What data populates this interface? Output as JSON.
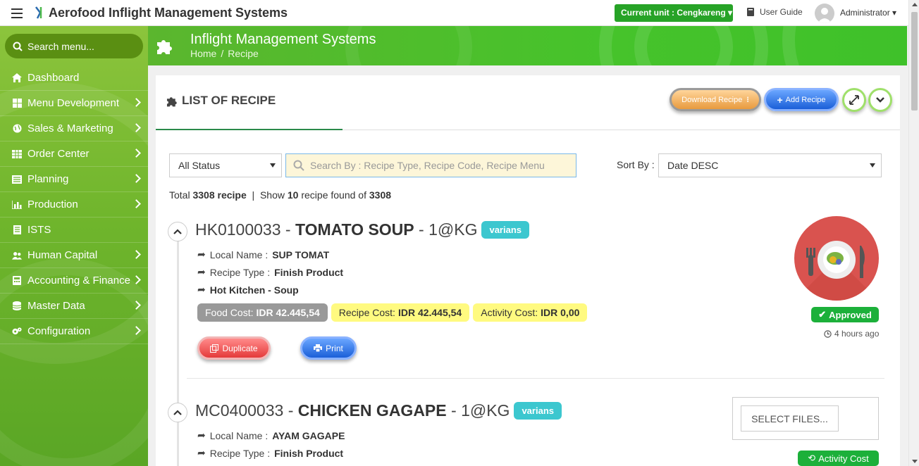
{
  "topbar": {
    "app_title": "Aerofood Inflight Management Systems",
    "unit_button": "Current unit : Cengkareng",
    "user_guide": "User Guide",
    "user": "Administrator"
  },
  "sidebar": {
    "search_placeholder": "Search menu...",
    "items": [
      {
        "label": "Dashboard",
        "icon": "home-icon",
        "has_submenu": false
      },
      {
        "label": "Menu Development",
        "icon": "windows-icon",
        "has_submenu": true
      },
      {
        "label": "Sales & Marketing",
        "icon": "globe-icon",
        "has_submenu": true
      },
      {
        "label": "Order Center",
        "icon": "grid-icon",
        "has_submenu": true
      },
      {
        "label": "Planning",
        "icon": "list-icon",
        "has_submenu": true
      },
      {
        "label": "Production",
        "icon": "bar-chart-icon",
        "has_submenu": true
      },
      {
        "label": "ISTS",
        "icon": "document-icon",
        "has_submenu": false
      },
      {
        "label": "Human Capital",
        "icon": "users-icon",
        "has_submenu": true
      },
      {
        "label": "Accounting & Finance",
        "icon": "calculator-icon",
        "has_submenu": true
      },
      {
        "label": "Master Data",
        "icon": "database-icon",
        "has_submenu": true
      },
      {
        "label": "Configuration",
        "icon": "gears-icon",
        "has_submenu": true
      }
    ]
  },
  "banner": {
    "title": "Inflight Management Systems",
    "breadcrumb": [
      "Home",
      "Recipe"
    ]
  },
  "panel": {
    "title": "LIST OF RECIPE",
    "download_button": "Download Recipe",
    "add_button": "Add Recipe"
  },
  "filters": {
    "status_value": "All Status",
    "search_placeholder": "Search By : Recipe Type, Recipe Code, Recipe Menu",
    "sort_label": "Sort By :",
    "sort_value": "Date DESC"
  },
  "summary": {
    "total_prefix": "Total",
    "total_count": "3308 recipe",
    "show_prefix": "Show",
    "show_count": "10",
    "found_text": "recipe found of",
    "found_count": "3308"
  },
  "recipes": [
    {
      "code": "HK0100033",
      "name": "TOMATO SOUP",
      "unit": "1@KG",
      "badge": "varians",
      "local_name_label": "Local Name :",
      "local_name": "SUP TOMAT",
      "type_label": "Recipe Type :",
      "type": "Finish Product",
      "category": "Hot Kitchen - Soup",
      "food_cost_label": "Food Cost:",
      "food_cost": "IDR 42.445,54",
      "recipe_cost_label": "Recipe Cost:",
      "recipe_cost": "IDR 42.445,54",
      "activity_cost_label": "Activity Cost:",
      "activity_cost": "IDR 0,00",
      "duplicate_button": "Duplicate",
      "print_button": "Print",
      "status": "Approved",
      "time_ago": "4 hours ago"
    },
    {
      "code": "MC0400033",
      "name": "CHICKEN GAGAPE",
      "unit": "1@KG",
      "badge": "varians",
      "local_name_label": "Local Name :",
      "local_name": "AYAM GAGAPE",
      "type_label": "Recipe Type :",
      "type": "Finish Product",
      "select_files_button": "SELECT FILES...",
      "activity_cost_badge": "Activity Cost"
    }
  ],
  "colors": {
    "sidebar_green": "#6fb52c",
    "banner_green": "#46c32b",
    "unit_button_green": "#27a327",
    "approved_green": "#1cb03a",
    "variant_teal": "#3cc7cf",
    "cost_yellow": "#fffa80"
  }
}
